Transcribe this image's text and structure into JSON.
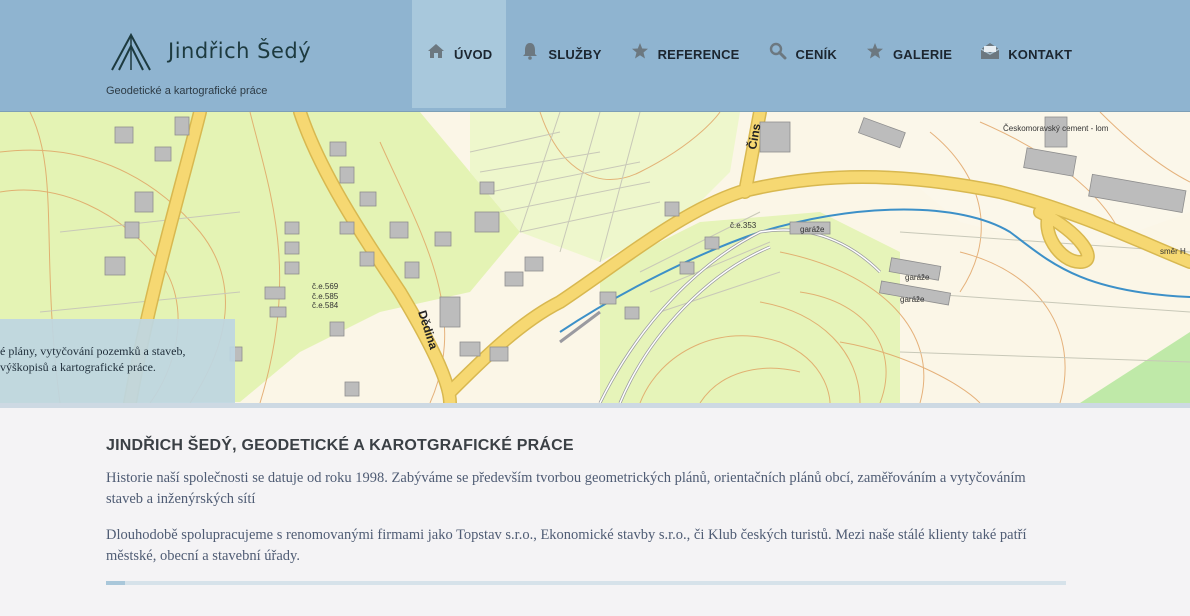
{
  "header": {
    "logo_text": "Jindřich Šedý",
    "tagline": "Geodetické a kartografické práce"
  },
  "nav": {
    "items": [
      {
        "label": "ÚVOD",
        "icon": "home-icon",
        "active": true
      },
      {
        "label": "SLUŽBY",
        "icon": "bell-icon",
        "active": false
      },
      {
        "label": "REFERENCE",
        "icon": "star-icon",
        "active": false
      },
      {
        "label": "CENÍK",
        "icon": "search-icon",
        "active": false
      },
      {
        "label": "GALERIE",
        "icon": "star-icon",
        "active": false
      },
      {
        "label": "KONTAKT",
        "icon": "envelope-icon",
        "active": false
      }
    ]
  },
  "hero": {
    "caption_line1": "é plány, vytyčování pozemků a staveb,",
    "caption_line2": " výškopisů a kartografické práce.",
    "map_labels": {
      "dedina": "Dědina",
      "cins": "Čins",
      "cement": "Českomoravský cement - lom",
      "smer": "směr H",
      "garaze1": "garáže",
      "garaze2": "garáže",
      "garaze3": "garáže",
      "ce569": "č.e.569",
      "ce585": "č.e.585",
      "ce584": "č.e.584",
      "ce353": "č.e.353"
    }
  },
  "content": {
    "title": "JINDŘICH ŠEDÝ, GEODETICKÉ A KAROTGRAFICKÉ PRÁCE",
    "paragraph1": "Historie naší společnosti se datuje od roku 1998. Zabýváme se především tvorbou geometrických plánů, orientačních plánů obcí, zaměřováním a vytyčováním staveb a inženýrských sítí",
    "paragraph2": "Dlouhodobě spolupracujeme s renomovanými firmami jako Topstav s.r.o., Ekonomické stavby s.r.o., či Klub českých turistů. Mezi naše stálé klienty také patří městské, obecní a stavební úřady."
  },
  "slider": {
    "progress_fraction": 0.02
  },
  "colors": {
    "header_bg": "#8fb4d0",
    "nav_active_bg": "#a8c8dc",
    "map_green": "#e1f2b0",
    "road_yellow": "#f6d872",
    "building_gray": "#b9b9b9",
    "contour_orange": "#e0a060",
    "river_blue": "#3c90c8"
  }
}
